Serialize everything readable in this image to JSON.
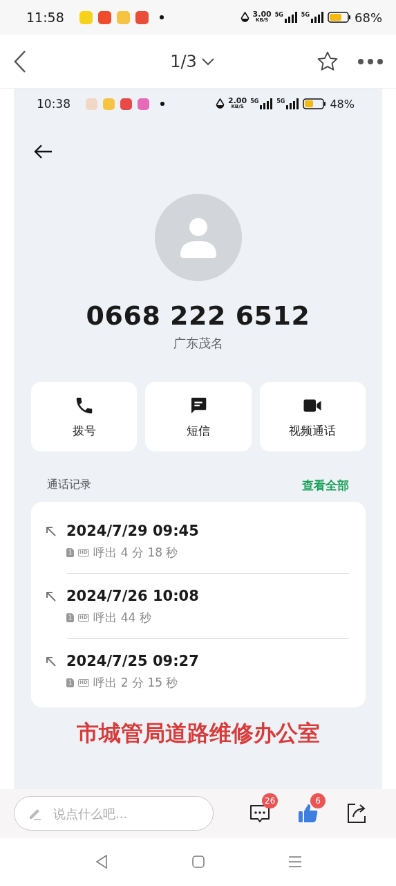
{
  "status_bar": {
    "time": "11:58",
    "net_speed": "3.00",
    "net_unit": "KB/S",
    "network_1": "5G",
    "network_2": "5G",
    "battery": "68%"
  },
  "top_bar": {
    "page": "1/3"
  },
  "screenshot": {
    "status_bar": {
      "time": "10:38",
      "net_speed": "2.00",
      "net_unit": "KB/S",
      "network_1": "5G",
      "network_2": "5G",
      "battery": "48%"
    },
    "contact": {
      "number": "0668 222 6512",
      "location": "广东茂名"
    },
    "actions": [
      {
        "kind": "call",
        "label": "拨号"
      },
      {
        "kind": "message",
        "label": "短信"
      },
      {
        "kind": "video",
        "label": "视频通话"
      }
    ],
    "history": {
      "title": "通话记录",
      "view_all": "查看全部",
      "calls": [
        {
          "datetime": "2024/7/29 09:45",
          "sim": "1",
          "quality": "HD",
          "direction": "呼出",
          "duration": "4 分 18 秒"
        },
        {
          "datetime": "2024/7/26 10:08",
          "sim": "1",
          "quality": "HD",
          "direction": "呼出",
          "duration": "44 秒"
        },
        {
          "datetime": "2024/7/25 09:27",
          "sim": "1",
          "quality": "HD",
          "direction": "呼出",
          "duration": "2 分 15 秒"
        }
      ]
    },
    "caption": "市城管局道路维修办公室"
  },
  "comment_bar": {
    "placeholder": "说点什么吧...",
    "comment_count": "26",
    "like_count": "6"
  }
}
